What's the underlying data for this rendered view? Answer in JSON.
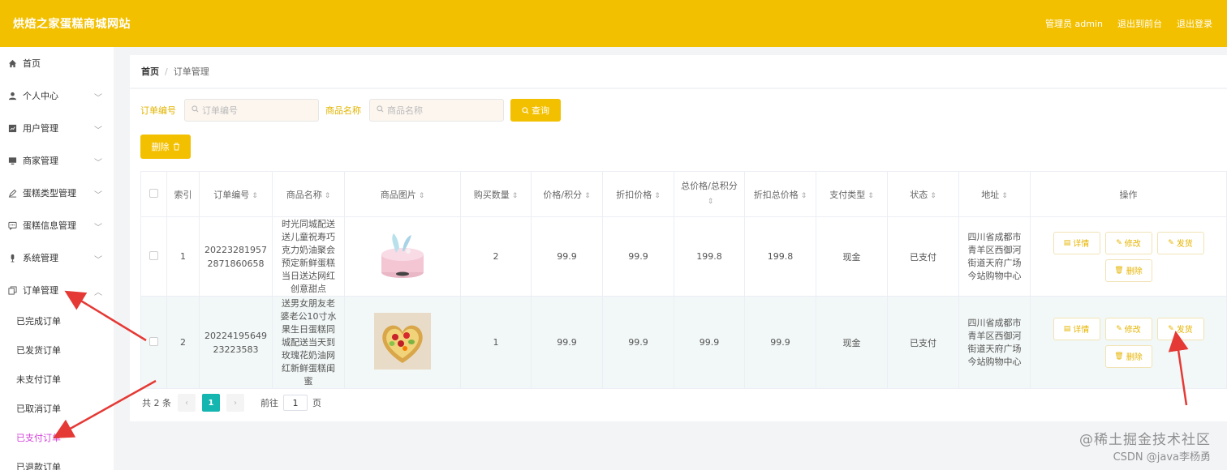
{
  "header": {
    "brand": "烘焙之家蛋糕商城网站",
    "admin_label": "管理员 admin",
    "front_label": "退出到前台",
    "logout_label": "退出登录"
  },
  "sidebar": {
    "items": [
      {
        "label": "首页",
        "icon": "home-icon"
      },
      {
        "label": "个人中心",
        "icon": "user-icon"
      },
      {
        "label": "用户管理",
        "icon": "chart-icon"
      },
      {
        "label": "商家管理",
        "icon": "monitor-icon"
      },
      {
        "label": "蛋糕类型管理",
        "icon": "edit-icon"
      },
      {
        "label": "蛋糕信息管理",
        "icon": "chat-icon"
      },
      {
        "label": "系统管理",
        "icon": "mic-icon"
      },
      {
        "label": "订单管理",
        "icon": "copy-icon"
      }
    ],
    "sub_items": [
      "已完成订单",
      "已发货订单",
      "未支付订单",
      "已取消订单",
      "已支付订单",
      "已退款订单"
    ],
    "active_sub": "已支付订单"
  },
  "breadcrumb": {
    "home": "首页",
    "sep": "/",
    "current": "订单管理"
  },
  "search": {
    "order_label": "订单编号",
    "order_placeholder": "订单编号",
    "product_label": "商品名称",
    "product_placeholder": "商品名称",
    "query_label": "查询"
  },
  "delete_label": "删除",
  "table": {
    "headers": [
      "索引",
      "订单编号",
      "商品名称",
      "商品图片",
      "购买数量",
      "价格/积分",
      "折扣价格",
      "总价格/总积分",
      "折扣总价格",
      "支付类型",
      "状态",
      "地址",
      "操作"
    ],
    "rows": [
      {
        "index": "1",
        "order_no": "202232819572871860658",
        "name": "时光同城配送送儿童祝寿巧克力奶油聚会预定新鲜蛋糕当日送达网红创意甜点",
        "qty": "2",
        "price": "99.9",
        "discount_price": "99.9",
        "total": "199.8",
        "discount_total": "199.8",
        "pay_type": "现金",
        "status": "已支付",
        "address": "四川省成都市青羊区西御河街道天府广场今站购物中心"
      },
      {
        "index": "2",
        "order_no": "2022419564923223583",
        "name": "送男女朋友老婆老公10寸水果生日蛋糕同城配送当天到玫瑰花奶油网红新鲜蛋糕闺蜜",
        "qty": "1",
        "price": "99.9",
        "discount_price": "99.9",
        "total": "99.9",
        "discount_total": "99.9",
        "pay_type": "现金",
        "status": "已支付",
        "address": "四川省成都市青羊区西御河街道天府广场今站购物中心"
      }
    ],
    "ops": {
      "detail": "详情",
      "edit": "修改",
      "ship": "发货",
      "delete": "删除"
    }
  },
  "pager": {
    "total": "共 2 条",
    "page": "1",
    "goto": "前往",
    "goto_value": "1",
    "page_suffix": "页"
  },
  "watermark": {
    "line1": "@稀土掘金技术社区",
    "line2": "CSDN @java李杨勇"
  },
  "colors": {
    "header": "#f3c000",
    "accent": "#e6b400",
    "active_sub": "#d23ed9",
    "pager_active": "#15b5b0"
  }
}
